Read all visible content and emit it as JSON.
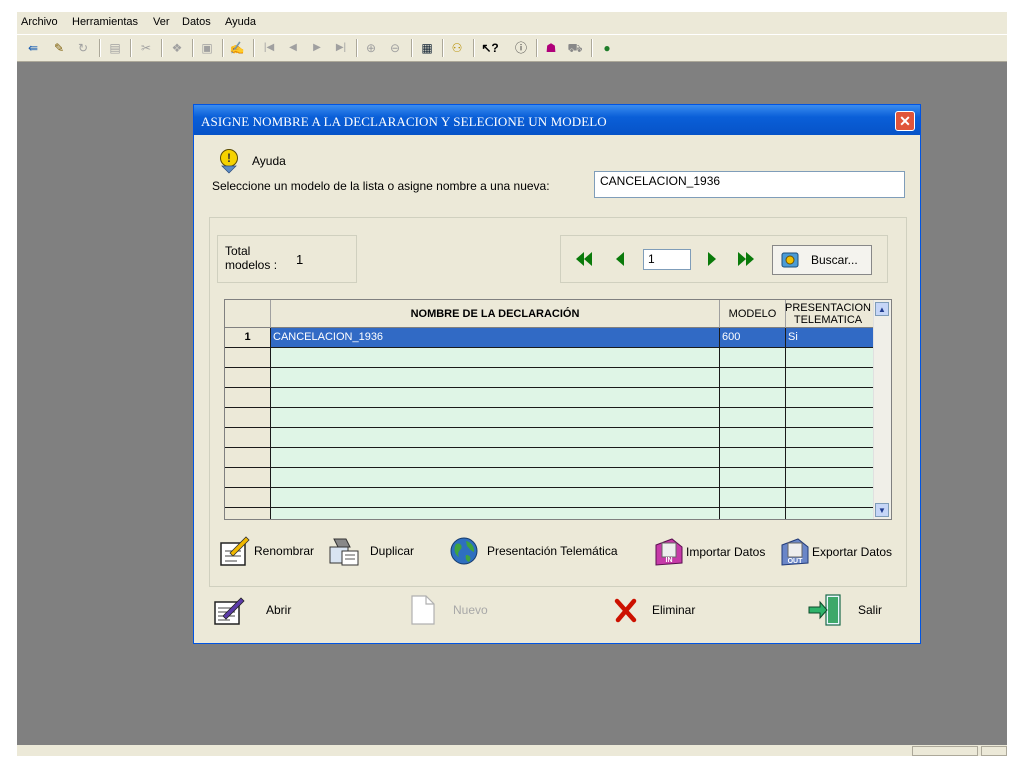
{
  "menu": [
    "Archivo",
    "Herramientas",
    "Ver",
    "Datos",
    "Ayuda"
  ],
  "toolbar_icons": [
    "open-icon",
    "edit-icon",
    "refresh-icon",
    "save-icon",
    "cut-icon",
    "paste-icon",
    "print-icon",
    "tools-icon",
    "first-record-icon",
    "prev-record-icon",
    "next-record-icon",
    "last-record-icon",
    "zoom-in-icon",
    "zoom-out-icon",
    "calculator-icon",
    "help-icon",
    "context-help-icon",
    "info-icon",
    "user-icon",
    "car-icon",
    "web-icon"
  ],
  "dialog": {
    "title": "ASIGNE NOMBRE A LA DECLARACION Y SELECIONE UN MODELO",
    "close_label": "✕",
    "help_label": "Ayuda",
    "prompt": "Seleccione un modelo de la lista o asigne nombre a una nueva:",
    "name_value": "CANCELACION_1936",
    "total_label": "Total modelos :",
    "total_value": "1",
    "page_value": "1",
    "search_label": "Buscar...",
    "columns": [
      "NOMBRE DE LA DECLARACIÓN",
      "MODELO",
      "PRESENTACION TELEMATICA"
    ],
    "rows": [
      {
        "num": "1",
        "name": "CANCELACION_1936",
        "modelo": "600",
        "telematica": "Si"
      }
    ],
    "actions": {
      "rename": "Renombrar",
      "duplicate": "Duplicar",
      "telematic": "Presentación Telemática",
      "import": "Importar Datos",
      "export": "Exportar Datos"
    },
    "buttons": {
      "open": "Abrir",
      "new": "Nuevo",
      "delete": "Eliminar",
      "exit": "Salir"
    }
  },
  "colors": {
    "titlebar": "#0653c8",
    "selection": "#316ac5",
    "empty_row": "#dff5e6",
    "nav_arrow": "#007000",
    "delete_x": "#cc1100"
  }
}
